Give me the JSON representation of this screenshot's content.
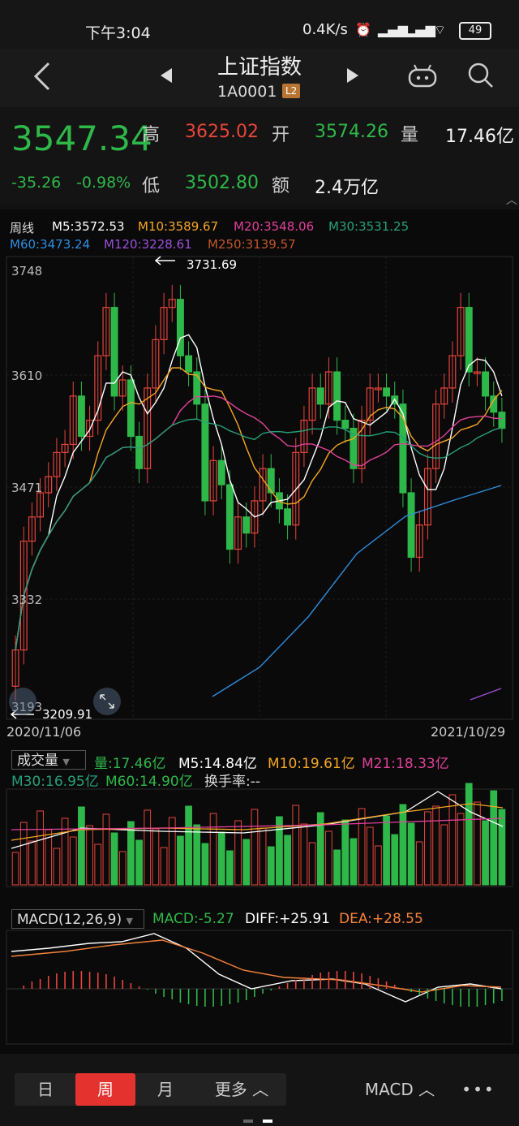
{
  "status": {
    "time": "下午3:04",
    "speed": "0.4K/s",
    "battery": "49"
  },
  "header": {
    "title": "上证指数",
    "code": "1A0001",
    "badge": "L2"
  },
  "quote": {
    "price": "3547.34",
    "change": "-35.26",
    "change_pct": "-0.98%",
    "high_label": "高",
    "high": "3625.02",
    "open_label": "开",
    "open": "3574.26",
    "volume_label": "量",
    "volume": "17.46亿",
    "low_label": "低",
    "low": "3502.80",
    "amount_label": "额",
    "amount": "2.4万亿"
  },
  "ma_legend": {
    "period": "周线",
    "m5": "M5:3572.53",
    "m10": "M10:3589.67",
    "m20": "M20:3548.06",
    "m30": "M30:3531.25",
    "m60": "M60:3473.24",
    "m120": "M120:3228.61",
    "m250": "M250:3139.57"
  },
  "price_axis": [
    "3748",
    "3610",
    "3471",
    "3332",
    "3193"
  ],
  "annotations": {
    "high": "3731.69",
    "low": "3209.91"
  },
  "dates": {
    "start": "2020/11/06",
    "end": "2021/10/29"
  },
  "volume_legend": {
    "selector": "成交量",
    "vol": "量:17.46亿",
    "m5": "M5:14.84亿",
    "m10": "M10:19.61亿",
    "m21": "M21:18.33亿",
    "m30": "M30:16.95亿",
    "m60": "M60:14.90亿",
    "turnover": "换手率:--"
  },
  "macd_legend": {
    "selector": "MACD(12,26,9)",
    "macd": "MACD:-5.27",
    "diff": "DIFF:+25.91",
    "dea": "DEA:+28.55"
  },
  "tabs": {
    "day": "日",
    "week": "周",
    "month": "月",
    "more": "更多 ︿",
    "indicator": "MACD ︿",
    "menu": "•••"
  },
  "colors": {
    "up": "#e8453c",
    "down": "#2fb84a",
    "m5": "#ffffff",
    "m10": "#f5a623",
    "m20": "#e0409a",
    "m30": "#26a07a",
    "m60": "#2d8ee0",
    "m120": "#9b4fd8",
    "m250": "#c0562a"
  }
}
